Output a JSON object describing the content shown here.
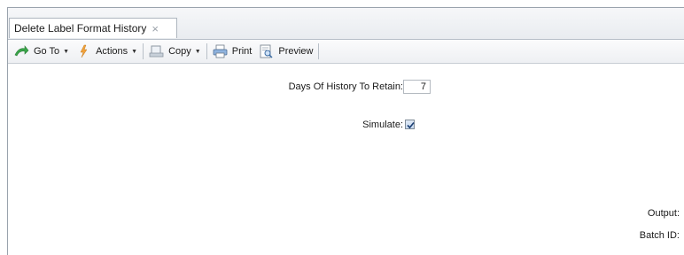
{
  "tab": {
    "title": "Delete Label Format History",
    "close_glyph": "×"
  },
  "toolbar": {
    "goto": {
      "label": "Go To",
      "icon": "goto-arrow-icon"
    },
    "actions": {
      "label": "Actions",
      "icon": "lightning-icon"
    },
    "copy": {
      "label": "Copy",
      "icon": "copy-icon"
    },
    "print": {
      "label": "Print",
      "icon": "printer-icon"
    },
    "preview": {
      "label": "Preview",
      "icon": "preview-icon"
    }
  },
  "form": {
    "days_label": "Days Of History To Retain:",
    "days_value": "7",
    "simulate_label": "Simulate:",
    "simulate_checked": true,
    "output_label": "Output:",
    "batch_label": "Batch ID:"
  },
  "colors": {
    "goto_green": "#3aa64a",
    "actions_orange": "#f2a23a",
    "checkbox_blue": "#c9daf0"
  }
}
